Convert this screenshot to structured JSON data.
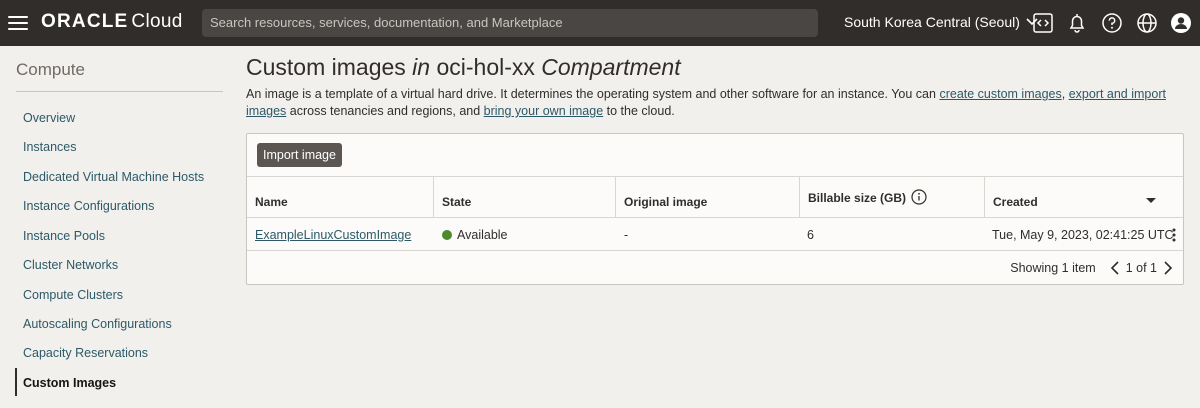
{
  "header": {
    "brand_bold": "ORACLE",
    "brand_cloud": "Cloud",
    "search_placeholder": "Search resources, services, documentation, and Marketplace",
    "region": "South Korea Central (Seoul)",
    "icons": [
      "hamburger-menu-icon",
      "code-editor-icon",
      "bell-icon",
      "help-icon",
      "globe-icon",
      "user-icon"
    ]
  },
  "sidebar": {
    "title": "Compute",
    "items": [
      {
        "label": "Overview"
      },
      {
        "label": "Instances"
      },
      {
        "label": "Dedicated Virtual Machine Hosts"
      },
      {
        "label": "Instance Configurations"
      },
      {
        "label": "Instance Pools"
      },
      {
        "label": "Cluster Networks"
      },
      {
        "label": "Compute Clusters"
      },
      {
        "label": "Autoscaling Configurations"
      },
      {
        "label": "Capacity Reservations"
      },
      {
        "label": "Custom Images",
        "active": true
      }
    ]
  },
  "main": {
    "title_a": "Custom images",
    "title_in": "in",
    "title_b": "oci-hol-xx",
    "title_c": "Compartment",
    "desc_1": "An image is a template of a virtual hard drive. It determines the operating system and other software for an instance. You can ",
    "link_1": "create custom images",
    "desc_2": ", ",
    "link_2": "export and import images",
    "desc_3": " across tenancies and regions, and ",
    "link_3": "bring your own image",
    "desc_4": " to the cloud.",
    "import_button": "Import image",
    "columns": [
      "Name",
      "State",
      "Original image",
      "Billable size (GB)",
      "Created"
    ],
    "rows": [
      {
        "name": "ExampleLinuxCustomImage",
        "state": "Available",
        "original_image": "-",
        "billable_size": "6",
        "created": "Tue, May 9, 2023, 02:41:25 UTC"
      }
    ],
    "status_color": "#4c8a2c",
    "pager_showing": "Showing 1 item",
    "pager_pages": "1 of 1"
  }
}
